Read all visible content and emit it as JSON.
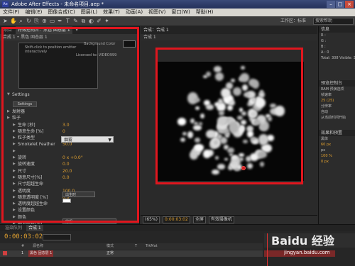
{
  "window": {
    "title": "Adobe After Effects - 未命名项目.aep *",
    "app_icon": "Ae",
    "buttons": [
      "–",
      "□",
      "×"
    ]
  },
  "menu": [
    "文件(F)",
    "编辑(E)",
    "图像合成(C)",
    "图层(L)",
    "效果(T)",
    "动画(A)",
    "视图(V)",
    "窗口(W)",
    "帮助(H)"
  ],
  "toolbar": {
    "tools": [
      "selection-arrow-icon",
      "hand-icon",
      "zoom-icon",
      "rotate-icon",
      "camera-icon",
      "pan-behind-icon",
      "rectangle-mask-icon",
      "pen-icon",
      "text-icon",
      "brush-icon",
      "clone-stamp-icon",
      "eraser-icon",
      "roto-brush-icon",
      "puppet-pin-icon"
    ],
    "tool_glyphs": [
      "➤",
      "✋",
      "⌕",
      "↻",
      "⎘",
      "⊕",
      "▭",
      "✒",
      "T",
      "✎",
      "⧉",
      "◐",
      "✐",
      "✦"
    ],
    "workspace_label": "工作区：标准",
    "search_placeholder": "搜索帮助"
  },
  "left_panel": {
    "tabs": [
      "项目",
      "特效控制台：黑色 固态层 1",
      "▾"
    ],
    "subhead": "合成 1 • 黑色 固态层 1",
    "preview_text_1": "Shift-click to position emitter interactively",
    "preview_text_2": "Licensed to: VIDEO999",
    "background_color_label": "Background Color",
    "settings_header": "Settings",
    "settings_button": "Settings",
    "rows": [
      {
        "indent": 1,
        "label": "发射器",
        "value": ""
      },
      {
        "indent": 1,
        "label": "粒子",
        "value": ""
      },
      {
        "indent": 2,
        "label": "生命 [秒]",
        "value": "3.0"
      },
      {
        "indent": 2,
        "label": "随意生命 [%]",
        "value": "0"
      },
      {
        "indent": 2,
        "label": "粒子类型",
        "value": ""
      },
      {
        "indent": 2,
        "label": "Smokelet Feather",
        "value": "50.0"
      },
      {
        "indent": 2,
        "label": "",
        "value": ""
      },
      {
        "indent": 2,
        "label": "旋转",
        "value": "0 x +0.0°"
      },
      {
        "indent": 2,
        "label": "旋转速度",
        "value": "0.0"
      },
      {
        "indent": 2,
        "label": "尺寸",
        "value": "20.0"
      },
      {
        "indent": 2,
        "label": "随意尺寸[%]",
        "value": "0.0"
      },
      {
        "indent": 2,
        "label": "尺寸超越生命",
        "value": ""
      },
      {
        "indent": 2,
        "label": "透明度",
        "value": "100.0"
      },
      {
        "indent": 2,
        "label": "随意透明度 [%]",
        "value": "0.0"
      },
      {
        "indent": 2,
        "label": "透明度超越生命",
        "value": ""
      },
      {
        "indent": 2,
        "label": "设置颜色",
        "value": ""
      },
      {
        "indent": 2,
        "label": "颜色",
        "value": ""
      },
      {
        "indent": 2,
        "label": "随意颜色[%]",
        "value": "0.0"
      },
      {
        "indent": 2,
        "label": "颜色超越生命",
        "value": ""
      },
      {
        "indent": 2,
        "label": "传递模式",
        "value": ""
      }
    ],
    "particle_type_value": "烟雾",
    "set_color_value": "出生时",
    "transfer_mode_value": "常规"
  },
  "comp_panel": {
    "tab": "合成：合成 1",
    "subtab": "合成 1",
    "zoom": "(65%)",
    "timecode": "0:00:03:02",
    "resolution": "全屏",
    "camera": "有效摄像机"
  },
  "right_panel": {
    "info_tab": "信息",
    "info_lines": [
      "R :",
      "G :",
      "B :",
      "A : 0"
    ],
    "info_total": "Total: 308  Visible: 308",
    "preview_tab": "预览控制台",
    "preview_lines": [
      "RAM 预演选项",
      "帧速率",
      "25 (25)",
      "分辨率",
      "自动",
      "从当前时间开始"
    ],
    "effects_tab": "效果和预置",
    "font_label": "黑体",
    "font_size": "60 px",
    "text_unit": "px",
    "tracking_value": "100 %",
    "scale_value": "0 px"
  },
  "timeline": {
    "tabs": [
      "渲染队列",
      "合成 1"
    ],
    "timecode": "0:00:03:02",
    "col_headers": [
      "#",
      "源名称",
      "模式",
      "T",
      "TrkMat"
    ],
    "layer_index": "1",
    "layer_name": "黑色 固态层 1",
    "layer_mode": "正常"
  },
  "watermark": {
    "text": "Baidu 经验",
    "sub": "jingyan.baidu.com"
  }
}
